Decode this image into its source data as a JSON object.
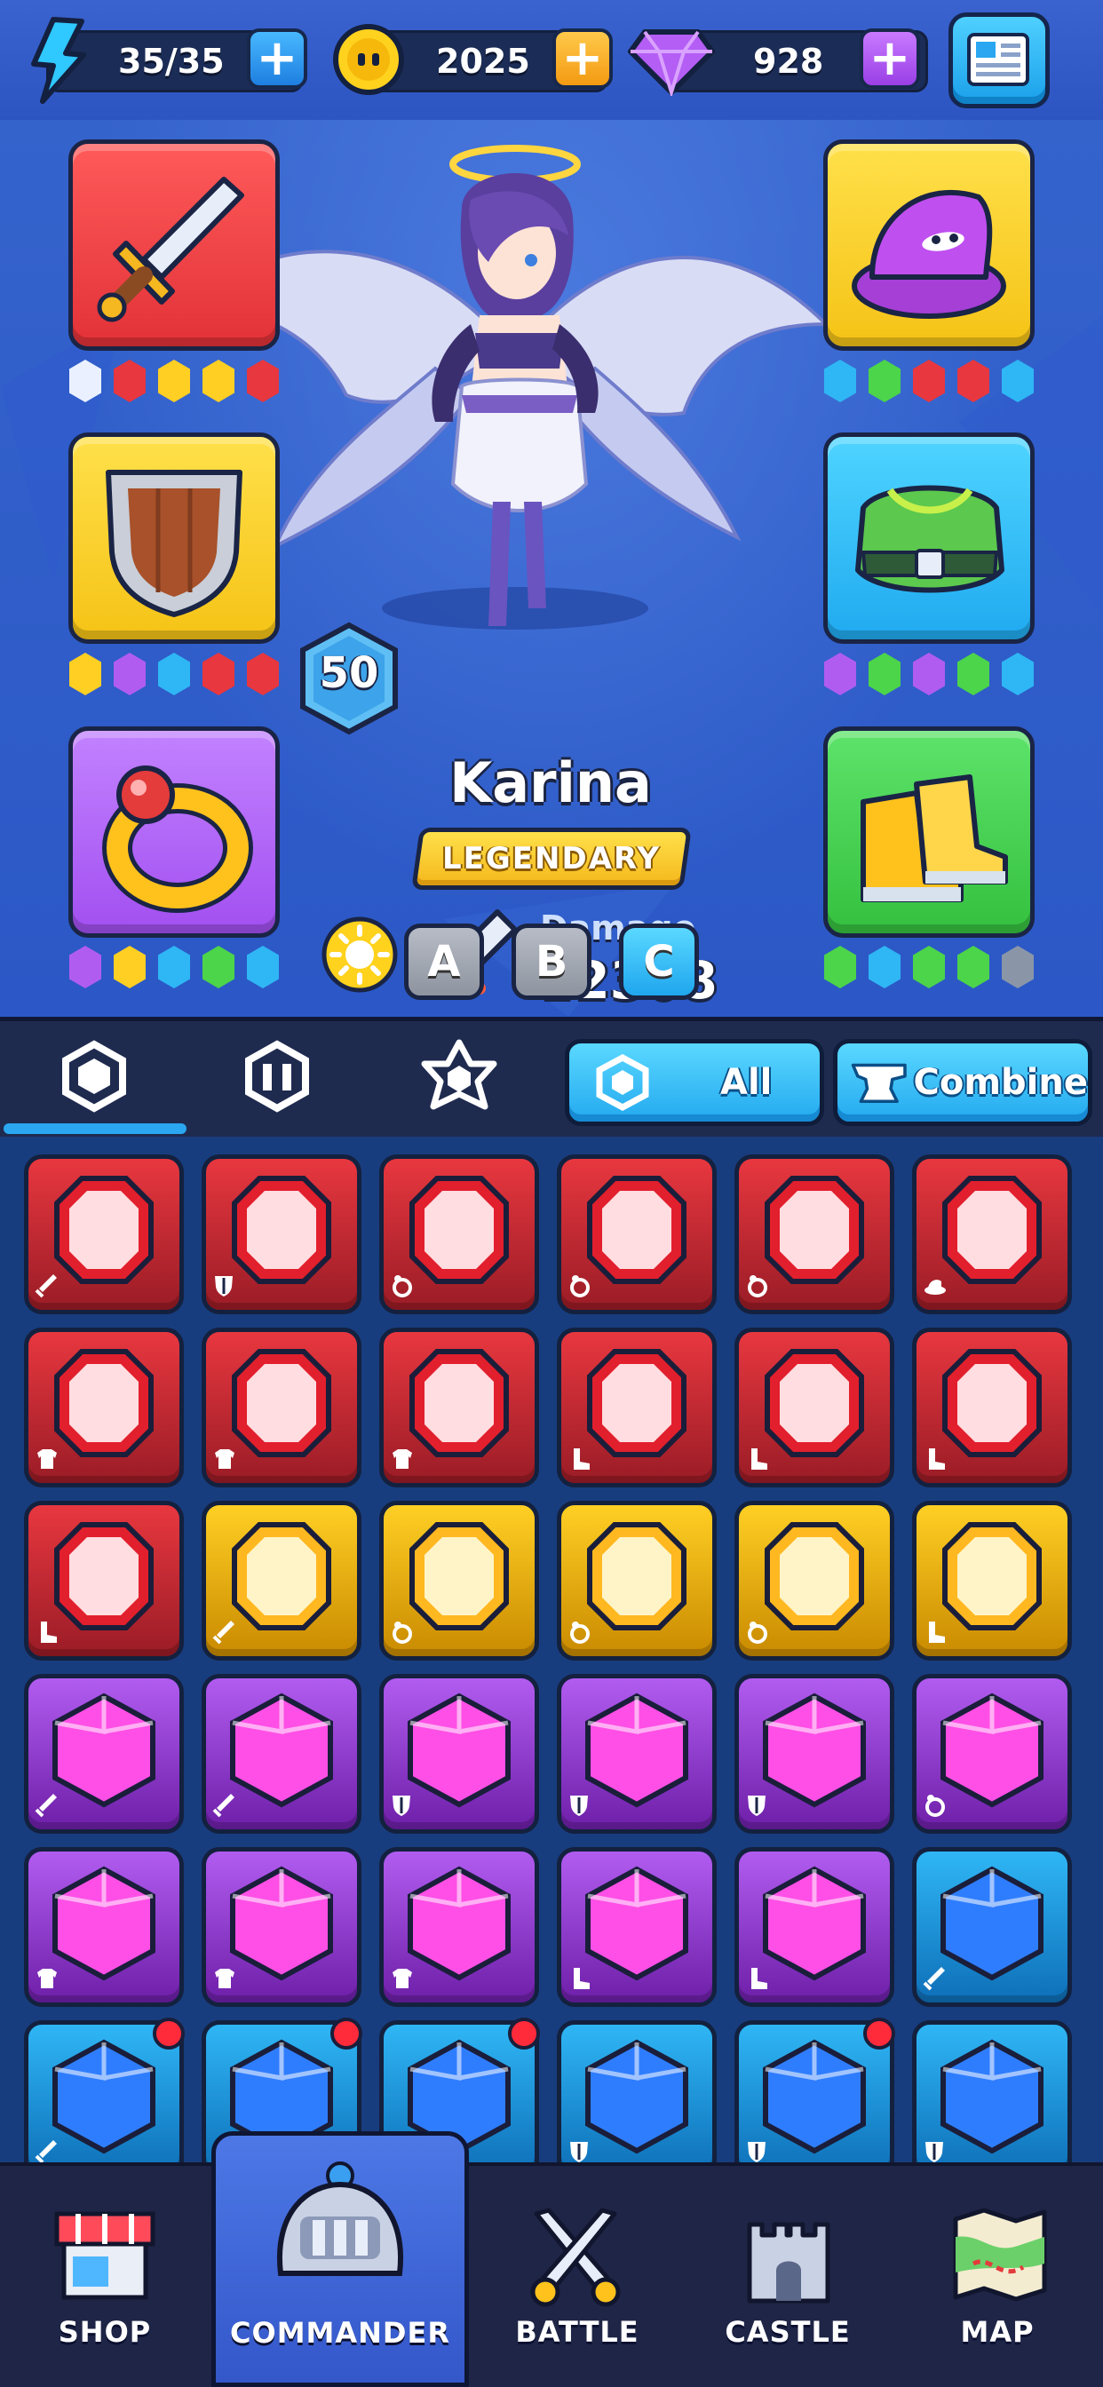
{
  "resources": {
    "energy": {
      "value": "35/35",
      "icon": "lightning-icon"
    },
    "coins": {
      "value": "2025",
      "icon": "coin-icon"
    },
    "gems": {
      "value": "928",
      "icon": "gem-icon"
    }
  },
  "hero": {
    "name": "Karina",
    "rarity": "LEGENDARY",
    "level": "50",
    "stat_label": "Damage",
    "stat_value": "12308",
    "element_icon": "sun-icon",
    "loadout_buttons": [
      "A",
      "B",
      "C"
    ]
  },
  "equipment": {
    "weapon": {
      "icon": "sword-icon",
      "gems": [
        "white",
        "red",
        "yellow",
        "yellow",
        "red"
      ]
    },
    "shield": {
      "icon": "shield-icon",
      "gems": [
        "yellow",
        "purple",
        "blue",
        "red",
        "red"
      ]
    },
    "ring": {
      "icon": "ring-icon",
      "gems": [
        "purple",
        "yellow",
        "blue",
        "green",
        "blue"
      ]
    },
    "hat": {
      "icon": "wizard-hat-icon",
      "gems": [
        "blue",
        "green",
        "red",
        "red",
        "blue"
      ]
    },
    "armor": {
      "icon": "armor-icon",
      "gems": [
        "purple",
        "green",
        "purple",
        "green",
        "blue"
      ]
    },
    "boots": {
      "icon": "boots-icon",
      "gems": [
        "green",
        "blue",
        "green",
        "green",
        "gray"
      ]
    }
  },
  "inventory_tabs": {
    "tabs": [
      "gem-icon",
      "gem-set-icon",
      "star-gem-icon"
    ],
    "filter_label": "All",
    "combine_label": "Combine"
  },
  "gems_grid": [
    [
      "red:sword",
      "red:shield",
      "red:ring",
      "red:ring",
      "red:ring",
      "red:hat"
    ],
    [
      "red:armor",
      "red:armor",
      "red:armor",
      "red:boot",
      "red:boot",
      "red:boot"
    ],
    [
      "red:boot",
      "yellow:sword",
      "yellow:ring",
      "yellow:ring",
      "yellow:ring",
      "yellow:boot"
    ],
    [
      "purple:sword",
      "purple:sword",
      "purple:shield",
      "purple:shield",
      "purple:shield",
      "purple:ring"
    ],
    [
      "purple:armor",
      "purple:armor",
      "purple:armor",
      "purple:boot",
      "purple:boot",
      "blue:sword"
    ],
    [
      "blue:sword:new",
      "blue:sword:new",
      "blue:ring:new",
      "blue:shield",
      "blue:shield:new",
      "blue:shield"
    ]
  ],
  "colors": {
    "red": "#e8373f",
    "yellow": "#ffcf24",
    "purple": "#b15cf0",
    "blue": "#2fb6f5",
    "green": "#4cd44a",
    "accent": "#2aa7f0"
  },
  "nav": {
    "items": [
      "SHOP",
      "COMMANDER",
      "BATTLE",
      "CASTLE",
      "MAP"
    ],
    "active": "COMMANDER"
  }
}
